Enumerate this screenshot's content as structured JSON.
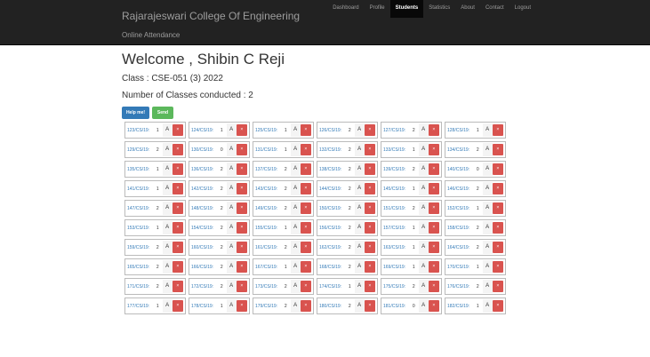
{
  "header": {
    "brand": "Rajarajeswari College Of Engineering",
    "subtitle": "Online Attendance",
    "nav": [
      "Dashboard",
      "Profile",
      "Students",
      "Statistics",
      "About",
      "Contact",
      "Logout"
    ],
    "active_nav": "Students"
  },
  "main": {
    "welcome": "Welcome , Shibin C Reji",
    "class_line": "Class : CSE-051 (3) 2022",
    "conducted": "Number of Classes conducted : 2",
    "help_label": "Help me!",
    "send_label": "Send",
    "mark_label": "A",
    "remove_symbol": "×"
  },
  "students": [
    {
      "roll": "123/CS/19:",
      "count": "1"
    },
    {
      "roll": "124/CS/19:",
      "count": "1"
    },
    {
      "roll": "125/CS/19:",
      "count": "1"
    },
    {
      "roll": "126/CS/19:",
      "count": "2"
    },
    {
      "roll": "127/CS/19:",
      "count": "2"
    },
    {
      "roll": "128/CS/19:",
      "count": "1"
    },
    {
      "roll": "129/CS/19:",
      "count": "2"
    },
    {
      "roll": "130/CS/19:",
      "count": "0"
    },
    {
      "roll": "131/CS/19:",
      "count": "1"
    },
    {
      "roll": "132/CS/19:",
      "count": "2"
    },
    {
      "roll": "133/CS/19:",
      "count": "1"
    },
    {
      "roll": "134/CS/19:",
      "count": "2"
    },
    {
      "roll": "135/CS/19:",
      "count": "1"
    },
    {
      "roll": "136/CS/19:",
      "count": "2"
    },
    {
      "roll": "137/CS/19:",
      "count": "2"
    },
    {
      "roll": "138/CS/19:",
      "count": "2"
    },
    {
      "roll": "139/CS/19:",
      "count": "2"
    },
    {
      "roll": "140/CS/19:",
      "count": "0"
    },
    {
      "roll": "141/CS/19:",
      "count": "1"
    },
    {
      "roll": "142/CS/19:",
      "count": "2"
    },
    {
      "roll": "143/CS/19:",
      "count": "2"
    },
    {
      "roll": "144/CS/19:",
      "count": "2"
    },
    {
      "roll": "145/CS/19:",
      "count": "1"
    },
    {
      "roll": "146/CS/19:",
      "count": "2"
    },
    {
      "roll": "147/CS/19:",
      "count": "2"
    },
    {
      "roll": "148/CS/19:",
      "count": "2"
    },
    {
      "roll": "149/CS/19:",
      "count": "2"
    },
    {
      "roll": "150/CS/19:",
      "count": "2"
    },
    {
      "roll": "151/CS/19:",
      "count": "2"
    },
    {
      "roll": "152/CS/19:",
      "count": "1"
    },
    {
      "roll": "153/CS/19:",
      "count": "1"
    },
    {
      "roll": "154/CS/19:",
      "count": "2"
    },
    {
      "roll": "155/CS/19:",
      "count": "1"
    },
    {
      "roll": "156/CS/19:",
      "count": "2"
    },
    {
      "roll": "157/CS/19:",
      "count": "1"
    },
    {
      "roll": "158/CS/19:",
      "count": "2"
    },
    {
      "roll": "159/CS/19:",
      "count": "2"
    },
    {
      "roll": "160/CS/19:",
      "count": "2"
    },
    {
      "roll": "161/CS/19:",
      "count": "2"
    },
    {
      "roll": "162/CS/19:",
      "count": "2"
    },
    {
      "roll": "163/CS/19:",
      "count": "1"
    },
    {
      "roll": "164/CS/19:",
      "count": "2"
    },
    {
      "roll": "165/CS/19:",
      "count": "2"
    },
    {
      "roll": "166/CS/19:",
      "count": "2"
    },
    {
      "roll": "167/CS/19:",
      "count": "1"
    },
    {
      "roll": "168/CS/19:",
      "count": "2"
    },
    {
      "roll": "169/CS/19:",
      "count": "1"
    },
    {
      "roll": "170/CS/19:",
      "count": "1"
    },
    {
      "roll": "171/CS/19:",
      "count": "2"
    },
    {
      "roll": "172/CS/19:",
      "count": "2"
    },
    {
      "roll": "173/CS/19:",
      "count": "2"
    },
    {
      "roll": "174/CS/19:",
      "count": "1"
    },
    {
      "roll": "175/CS/19:",
      "count": "2"
    },
    {
      "roll": "176/CS/19:",
      "count": "2"
    },
    {
      "roll": "177/CS/19:",
      "count": "1"
    },
    {
      "roll": "178/CS/19:",
      "count": "1"
    },
    {
      "roll": "179/CS/19:",
      "count": "2"
    },
    {
      "roll": "180/CS/19:",
      "count": "2"
    },
    {
      "roll": "181/CS/19:",
      "count": "0"
    },
    {
      "roll": "182/CS/19:",
      "count": "1"
    }
  ],
  "colors": {
    "navbar": "#222222",
    "help": "#337ab7",
    "send": "#5cb85c",
    "remove": "#d9534f"
  }
}
